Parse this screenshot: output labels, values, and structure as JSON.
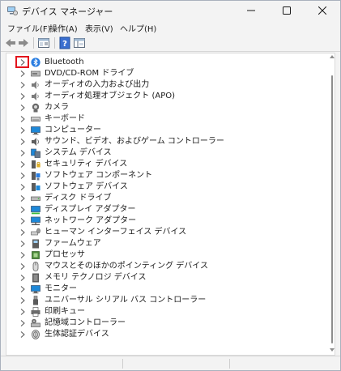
{
  "window": {
    "title": "デバイス マネージャー"
  },
  "menu": [
    {
      "label": "ファイル(F)"
    },
    {
      "label": "操作(A)"
    },
    {
      "label": "表示(V)"
    },
    {
      "label": "ヘルプ(H)"
    }
  ],
  "toolbar": {
    "icons": [
      "back-arrow-icon",
      "forward-arrow-icon",
      "properties-pane-icon",
      "help-icon",
      "console-tree-icon"
    ]
  },
  "tree": {
    "items": [
      {
        "label": "Bluetooth",
        "icon": "bluetooth-icon",
        "selected": true
      },
      {
        "label": "DVD/CD-ROM ドライブ",
        "icon": "dvd-drive-icon"
      },
      {
        "label": "オーディオの入力および出力",
        "icon": "audio-io-icon"
      },
      {
        "label": "オーディオ処理オブジェクト (APO)",
        "icon": "audio-processing-icon"
      },
      {
        "label": "カメラ",
        "icon": "camera-icon"
      },
      {
        "label": "キーボード",
        "icon": "keyboard-icon"
      },
      {
        "label": "コンピューター",
        "icon": "computer-icon"
      },
      {
        "label": "サウンド、ビデオ、およびゲーム コントローラー",
        "icon": "sound-video-game-icon"
      },
      {
        "label": "システム デバイス",
        "icon": "system-devices-icon"
      },
      {
        "label": "セキュリティ デバイス",
        "icon": "security-devices-icon"
      },
      {
        "label": "ソフトウェア コンポーネント",
        "icon": "software-component-icon"
      },
      {
        "label": "ソフトウェア デバイス",
        "icon": "software-device-icon"
      },
      {
        "label": "ディスク ドライブ",
        "icon": "disk-drive-icon"
      },
      {
        "label": "ディスプレイ アダプター",
        "icon": "display-adapter-icon"
      },
      {
        "label": "ネットワーク アダプター",
        "icon": "network-adapter-icon"
      },
      {
        "label": "ヒューマン インターフェイス デバイス",
        "icon": "hid-icon"
      },
      {
        "label": "ファームウェア",
        "icon": "firmware-icon"
      },
      {
        "label": "プロセッサ",
        "icon": "processor-icon"
      },
      {
        "label": "マウスとそのほかのポインティング デバイス",
        "icon": "mouse-icon"
      },
      {
        "label": "メモリ テクノロジ デバイス",
        "icon": "memory-technology-icon"
      },
      {
        "label": "モニター",
        "icon": "monitor-icon"
      },
      {
        "label": "ユニバーサル シリアル バス コントローラー",
        "icon": "usb-controller-icon"
      },
      {
        "label": "印刷キュー",
        "icon": "print-queue-icon"
      },
      {
        "label": "記憶域コントローラー",
        "icon": "storage-controller-icon"
      },
      {
        "label": "生体認証デバイス",
        "icon": "biometric-icon"
      }
    ]
  },
  "colors": {
    "highlight_border": "#e3141d",
    "bluetooth_blue": "#2a7de1",
    "monitor_blue": "#1e88d8"
  }
}
